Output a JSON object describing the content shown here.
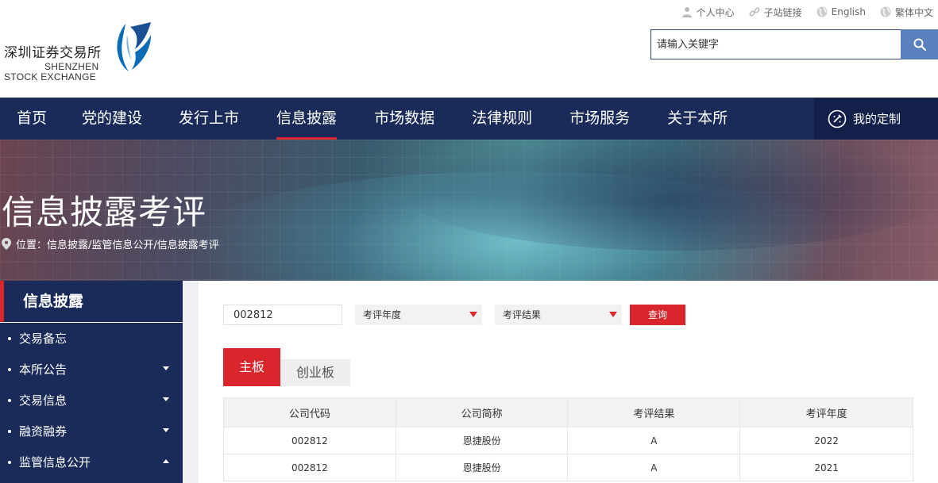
{
  "header": {
    "logo_cn": "深圳证券交易所",
    "logo_en_line1": "SHENZHEN",
    "logo_en_line2": "STOCK EXCHANGE",
    "top_links": [
      {
        "label": "个人中心",
        "icon": "user-icon"
      },
      {
        "label": "子站链接",
        "icon": "link-icon"
      },
      {
        "label": "English",
        "icon": "globe-icon"
      },
      {
        "label": "繁体中文",
        "icon": "globe-icon"
      }
    ],
    "search": {
      "placeholder": "请输入关键字"
    }
  },
  "nav": {
    "items": [
      {
        "label": "首页",
        "active": false
      },
      {
        "label": "党的建设",
        "active": false
      },
      {
        "label": "发行上市",
        "active": false
      },
      {
        "label": "信息披露",
        "active": true
      },
      {
        "label": "市场数据",
        "active": false
      },
      {
        "label": "法律规则",
        "active": false
      },
      {
        "label": "市场服务",
        "active": false
      },
      {
        "label": "关于本所",
        "active": false
      }
    ],
    "custom_label": "我的定制"
  },
  "banner": {
    "title": "信息披露考评",
    "breadcrumb": "位置：信息披露/监管信息公开/信息披露考评"
  },
  "sidebar": {
    "heading": "信息披露",
    "items": [
      {
        "label": "交易备忘",
        "caret": "none"
      },
      {
        "label": "本所公告",
        "caret": "down"
      },
      {
        "label": "交易信息",
        "caret": "down"
      },
      {
        "label": "融资融券",
        "caret": "down"
      },
      {
        "label": "监管信息公开",
        "caret": "up"
      }
    ]
  },
  "filters": {
    "code_value": "002812",
    "year_select": "考评年度",
    "result_select": "考评结果",
    "query_label": "查询"
  },
  "tabs": [
    {
      "label": "主板",
      "active": true
    },
    {
      "label": "创业板",
      "active": false
    }
  ],
  "table": {
    "headers": [
      "公司代码",
      "公司简称",
      "考评结果",
      "考评年度"
    ],
    "rows": [
      [
        "002812",
        "恩捷股份",
        "A",
        "2022"
      ],
      [
        "002812",
        "恩捷股份",
        "A",
        "2021"
      ]
    ]
  },
  "colors": {
    "nav_bg": "#1a2b5a",
    "accent_red": "#d9262c",
    "search_btn": "#5b7fbd"
  }
}
